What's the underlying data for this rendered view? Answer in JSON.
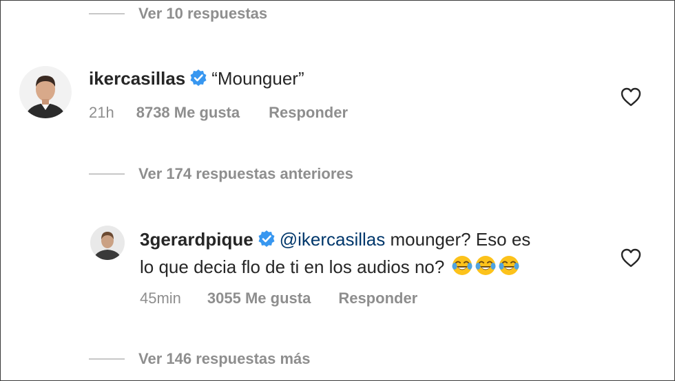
{
  "top_replies": {
    "label": "Ver 10 respuestas"
  },
  "comment1": {
    "username": "ikercasillas",
    "text": "“Mounguer”",
    "time": "21h",
    "likes": "8738 Me gusta",
    "reply": "Responder"
  },
  "previous_replies": {
    "label": "Ver 174 respuestas anteriores"
  },
  "comment2": {
    "username": "3gerardpique",
    "mention": "@ikercasillas",
    "text_line1": " mounger? Eso es",
    "text_line2": "lo que decia flo de ti en los audios no? ",
    "emoji": [
      "face-with-tears-of-joy",
      "face-with-tears-of-joy",
      "face-with-tears-of-joy"
    ],
    "time": "45min",
    "likes": "3055 Me gusta",
    "reply": "Responder"
  },
  "more_replies": {
    "label": "Ver 146 respuestas más"
  },
  "colors": {
    "verified": "#3897f0",
    "mention": "#00376b",
    "meta": "#8e8e8e"
  }
}
